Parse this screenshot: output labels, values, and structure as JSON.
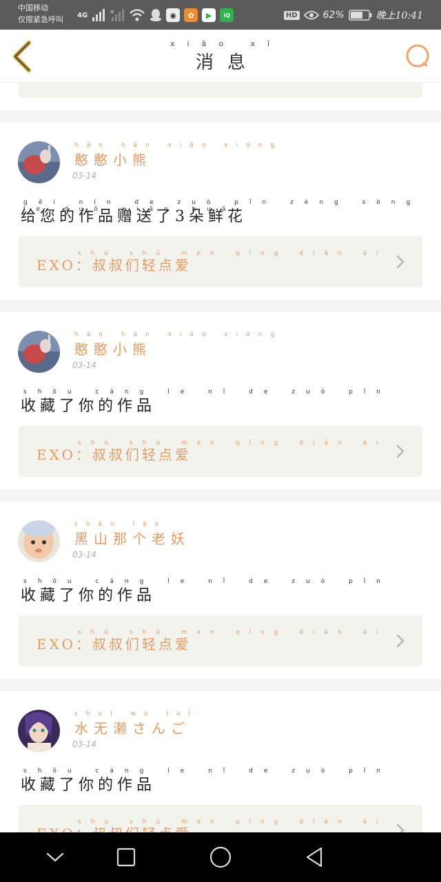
{
  "status_bar": {
    "carrier_line1": "中国移动",
    "carrier_line2": "仅限紧急呼叫",
    "network": "4G",
    "battery": "62%",
    "time": "晚上10:41",
    "hd": "HD",
    "icons": [
      "signal-icon",
      "no-signal-icon",
      "wifi-icon",
      "qq-icon",
      "app-icon-1",
      "app-icon-2",
      "video-icon",
      "iqiyi-icon"
    ]
  },
  "header": {
    "title": "消息",
    "title_pinyin": "xiāo xī",
    "back_icon": "chevron-left-icon",
    "search_icon": "search-icon",
    "accent": "#e69a62"
  },
  "messages": [
    {
      "name": "憨憨小熊",
      "name_pinyin": "hān hān xiǎo xióng",
      "date": "03-14",
      "action": "给您的作品赠送了3朵鲜花",
      "action_pinyin": "gěi nín de zuò pǐn zèng sòng le duǒ xiān huā",
      "work_title": "EXO：叔叔们轻点爱",
      "work_pinyin": "shū shū men qīng diǎn ài"
    },
    {
      "name": "憨憨小熊",
      "name_pinyin": "hān hān xiǎo xióng",
      "date": "03-14",
      "action": "收藏了你的作品",
      "action_pinyin": "shōu cáng le nǐ de zuò pǐn",
      "work_title": "EXO：叔叔们轻点爱",
      "work_pinyin": "shū shū men qīng diǎn ài"
    },
    {
      "name": "黑山那个老妖",
      "name_pinyin": "shān lǎo",
      "date": "03-14",
      "action": "收藏了你的作品",
      "action_pinyin": "shōu cáng le nǐ de zuò pǐn",
      "work_title": "EXO：叔叔们轻点爱",
      "work_pinyin": "shū shū men qīng diǎn ài"
    },
    {
      "name": "水无濑さんご",
      "name_pinyin": "shuǐ wú lài",
      "date": "03-14",
      "action": "收藏了你的作品",
      "action_pinyin": "shōu cáng le nǐ de zuò pǐn",
      "work_title": "EXO：叔叔们轻点爱",
      "work_pinyin": "shū shū men qīng diǎn ài"
    }
  ],
  "nav_bar": {
    "icons": [
      "collapse-icon",
      "recents-icon",
      "home-icon",
      "back-icon"
    ]
  }
}
